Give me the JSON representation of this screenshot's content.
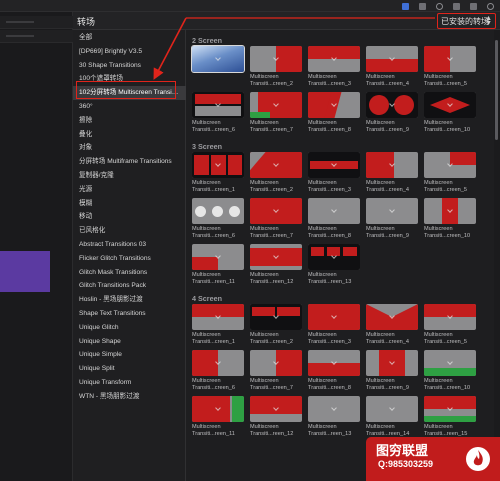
{
  "header": {
    "title": "转场",
    "dropdown_label": "已安装的转场"
  },
  "categories": [
    {
      "label": "全部",
      "selected": false
    },
    {
      "label": "[DP669] Brightly V3.5",
      "selected": false
    },
    {
      "label": "30 Shape Transitions",
      "selected": false
    },
    {
      "label": "100个遮罩转场",
      "selected": false
    },
    {
      "label": "102分屏转场 Multiscreen Transi…",
      "selected": true
    },
    {
      "label": "360°",
      "selected": false
    },
    {
      "label": "擦除",
      "selected": false
    },
    {
      "label": "叠化",
      "selected": false
    },
    {
      "label": "对象",
      "selected": false
    },
    {
      "label": "分屏转场 Multiframe Transitions",
      "selected": false
    },
    {
      "label": "复制器/克隆",
      "selected": false
    },
    {
      "label": "光源",
      "selected": false
    },
    {
      "label": "模糊",
      "selected": false
    },
    {
      "label": "移动",
      "selected": false
    },
    {
      "label": "已风格化",
      "selected": false
    },
    {
      "label": "Abstract Transitions 03",
      "selected": false
    },
    {
      "label": "Flicker Glitch Transitions",
      "selected": false
    },
    {
      "label": "Glitch Mask Transitions",
      "selected": false
    },
    {
      "label": "Glitch Transitions Pack",
      "selected": false
    },
    {
      "label": "Hoslin - 黑场朋影过渡",
      "selected": false
    },
    {
      "label": "Shape Text Transitions",
      "selected": false
    },
    {
      "label": "Unique Glitch",
      "selected": false
    },
    {
      "label": "Unique Shape",
      "selected": false
    },
    {
      "label": "Unique Simple",
      "selected": false
    },
    {
      "label": "Unique Split",
      "selected": false
    },
    {
      "label": "Unique Transform",
      "selected": false
    },
    {
      "label": "WTN - 黑场朋影过渡",
      "selected": false
    }
  ],
  "sections": [
    {
      "label": "2 Screen",
      "rows": [
        [
          {
            "line1": "",
            "line2": "",
            "style": "a1"
          },
          {
            "line1": "Multiscreen",
            "line2": "Transiti...creen_2",
            "style": "a2"
          },
          {
            "line1": "Multiscreen",
            "line2": "Transiti...creen_3",
            "style": "a3"
          },
          {
            "line1": "Multiscreen",
            "line2": "Transiti...creen_4",
            "style": "a4"
          },
          {
            "line1": "Multiscreen",
            "line2": "Transiti...creen_5",
            "style": "a5"
          }
        ],
        [
          {
            "line1": "Multiscreen",
            "line2": "Transiti...creen_6",
            "style": "b1"
          },
          {
            "line1": "Multiscreen",
            "line2": "Transiti...creen_7",
            "style": "b2"
          },
          {
            "line1": "Multiscreen",
            "line2": "Transiti...creen_8",
            "style": "b3"
          },
          {
            "line1": "Multiscreen",
            "line2": "Transiti...creen_9",
            "style": "b4"
          },
          {
            "line1": "Multiscreen",
            "line2": "Transiti...creen_10",
            "style": "b5"
          }
        ]
      ]
    },
    {
      "label": "3 Screen",
      "rows": [
        [
          {
            "line1": "Multiscreen",
            "line2": "Transiti...creen_1",
            "style": "c1"
          },
          {
            "line1": "Multiscreen",
            "line2": "Transiti...creen_2",
            "style": "c2"
          },
          {
            "line1": "Multiscreen",
            "line2": "Transiti...creen_3",
            "style": "c3"
          },
          {
            "line1": "Multiscreen",
            "line2": "Transiti...creen_4",
            "style": "c4"
          },
          {
            "line1": "Multiscreen",
            "line2": "Transiti...creen_5",
            "style": "c5"
          }
        ],
        [
          {
            "line1": "Multiscreen",
            "line2": "Transiti...creen_6",
            "style": "d1"
          },
          {
            "line1": "Multiscreen",
            "line2": "Transiti...creen_7",
            "style": "d2"
          },
          {
            "line1": "Multiscreen",
            "line2": "Transiti...creen_8",
            "style": "d3"
          },
          {
            "line1": "Multiscreen",
            "line2": "Transiti...creen_9",
            "style": "d4"
          },
          {
            "line1": "Multiscreen",
            "line2": "Transiti...creen_10",
            "style": "d5"
          }
        ],
        [
          {
            "line1": "Multiscreen",
            "line2": "Transiti...reen_11",
            "style": "e1"
          },
          {
            "line1": "Multiscreen",
            "line2": "Transiti...reen_12",
            "style": "e2"
          },
          {
            "line1": "Multiscreen",
            "line2": "Transiti...reen_13",
            "style": "e3"
          }
        ]
      ]
    },
    {
      "label": "4 Screen",
      "rows": [
        [
          {
            "line1": "Multiscreen",
            "line2": "Transiti...creen_1",
            "style": "f1"
          },
          {
            "line1": "Multiscreen",
            "line2": "Transiti...creen_2",
            "style": "f2"
          },
          {
            "line1": "Multiscreen",
            "line2": "Transiti...creen_3",
            "style": "f3"
          },
          {
            "line1": "Multiscreen",
            "line2": "Transiti...creen_4",
            "style": "f4"
          },
          {
            "line1": "Multiscreen",
            "line2": "Transiti...creen_5",
            "style": "f5"
          }
        ],
        [
          {
            "line1": "Multiscreen",
            "line2": "Transiti...creen_6",
            "style": "g1"
          },
          {
            "line1": "Multiscreen",
            "line2": "Transiti...creen_7",
            "style": "g2"
          },
          {
            "line1": "Multiscreen",
            "line2": "Transiti...creen_8",
            "style": "g3"
          },
          {
            "line1": "Multiscreen",
            "line2": "Transiti...creen_9",
            "style": "g4"
          },
          {
            "line1": "Multiscreen",
            "line2": "Transiti...creen_10",
            "style": "g5"
          }
        ],
        [
          {
            "line1": "Multiscreen",
            "line2": "Transiti...reen_11",
            "style": "h1"
          },
          {
            "line1": "Multiscreen",
            "line2": "Transiti...reen_12",
            "style": "h2"
          },
          {
            "line1": "Multiscreen",
            "line2": "Transiti...reen_13",
            "style": "h3"
          },
          {
            "line1": "Multiscreen",
            "line2": "Transiti...reen_14",
            "style": "h4"
          },
          {
            "line1": "Multiscreen",
            "line2": "Transiti...reen_15",
            "style": "h5"
          }
        ]
      ]
    }
  ],
  "watermark": {
    "name": "图穷联盟",
    "qq": "Q:985303259"
  },
  "colors": {
    "accent_red": "#e0241b",
    "tile_red": "#c21d1d",
    "tile_gray": "#8c8c8e",
    "tile_green": "#2ea043",
    "track_purple": "#5b3aa1"
  },
  "icons": [
    "camera-icon",
    "grid-icon",
    "headphones-icon",
    "wifi-icon",
    "display-icon",
    "cog-icon"
  ]
}
